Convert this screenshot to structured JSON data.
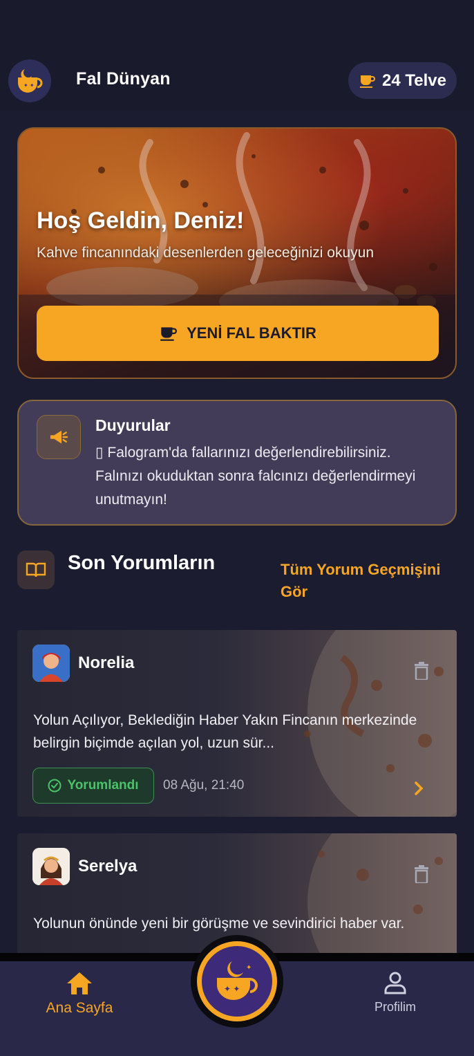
{
  "header": {
    "app_title": "Fal Dünyan",
    "telve_label": "24 Telve"
  },
  "hero": {
    "title": "Hoş Geldin, Deniz!",
    "subtitle": "Kahve fincanındaki desenlerden geleceğinizi okuyun",
    "button_label": "YENİ FAL BAKTIR"
  },
  "announcements": {
    "title": "Duyurular",
    "text": "▯ Falogram'da fallarınızı değerlendirebilirsiniz. Falınızı okuduktan sonra falcınızı değerlendirmeyi unutmayın!"
  },
  "recent": {
    "title": "Son Yorumların",
    "link_label": "Tüm Yorum Geçmişini Gör",
    "items": [
      {
        "reader": "Norelia",
        "text": "Yolun Açılıyor, Beklediğin Haber Yakın Fincanın merkezinde belirgin biçimde açılan yol, uzun sür...",
        "status": "Yorumlandı",
        "date": "08 Ağu, 21:40"
      },
      {
        "reader": "Serelya",
        "text": "Yolunun önünde yeni bir görüşme ve sevindirici haber var."
      }
    ]
  },
  "nav": {
    "home_label": "Ana Sayfa",
    "profile_label": "Profilim"
  },
  "colors": {
    "accent": "#f6a623",
    "background": "#1c1c30",
    "success": "#4cc36a"
  },
  "icons": [
    "logo-cup-icon",
    "coffee-cup-icon",
    "megaphone-icon",
    "book-icon",
    "trash-icon",
    "check-circle-icon",
    "chevron-right-icon",
    "home-icon",
    "user-icon"
  ]
}
